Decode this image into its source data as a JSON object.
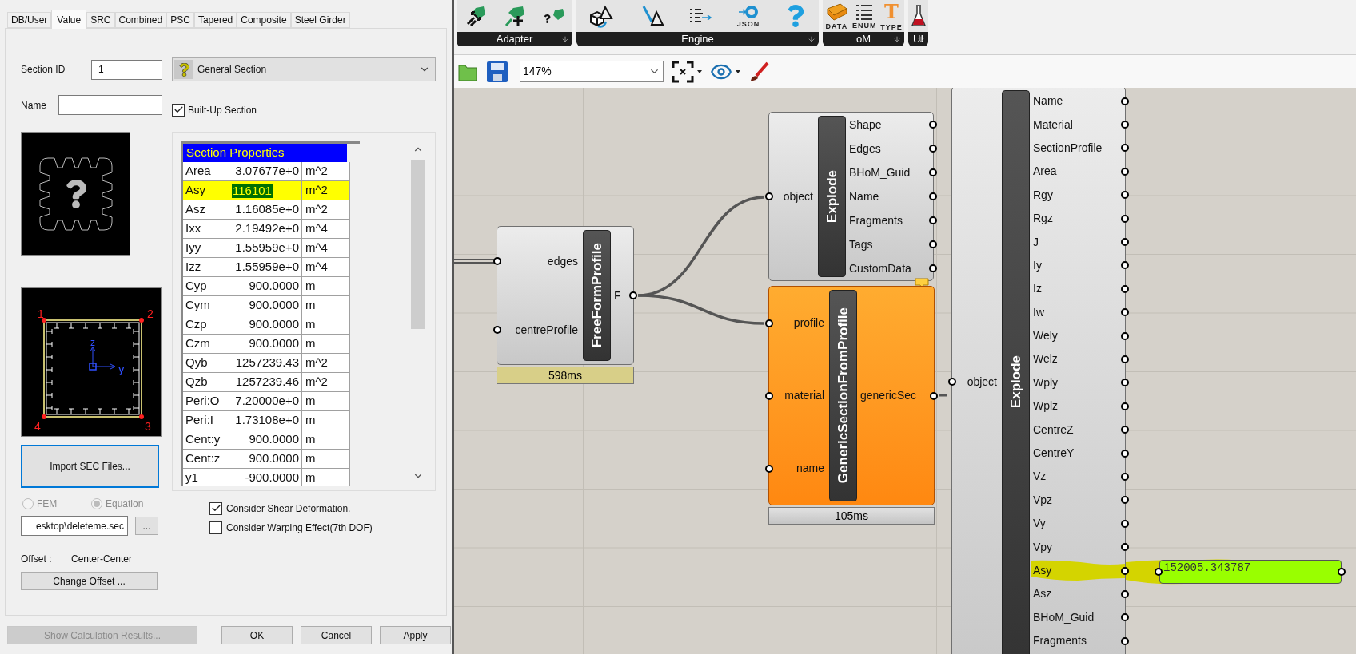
{
  "dialog": {
    "tabs": [
      {
        "label": "DB/User",
        "selected": false
      },
      {
        "label": "Value",
        "selected": true
      },
      {
        "label": "SRC",
        "selected": false
      },
      {
        "label": "Combined",
        "selected": false
      },
      {
        "label": "PSC",
        "selected": false
      },
      {
        "label": "Tapered",
        "selected": false
      },
      {
        "label": "Composite",
        "selected": false
      },
      {
        "label": "Steel Girder",
        "selected": false
      }
    ],
    "section_id": {
      "label": "Section ID",
      "value": "1"
    },
    "section_type": {
      "value": "General Section"
    },
    "name": {
      "label": "Name"
    },
    "built_up": {
      "label": "Built-Up Section",
      "checked": true
    },
    "section_drawing": {
      "corners": [
        "1",
        "2",
        "4",
        "3"
      ],
      "axes": [
        "z",
        "y"
      ]
    },
    "properties": {
      "title": "Section Properties",
      "rows": [
        {
          "name": "Area",
          "value": "3.07677e+0",
          "unit": "m^2",
          "highlighted": false
        },
        {
          "name": "Asy",
          "value": "116101",
          "unit": "m^2",
          "highlighted": true
        },
        {
          "name": "Asz",
          "value": "1.16085e+0",
          "unit": "m^2",
          "highlighted": false
        },
        {
          "name": "Ixx",
          "value": "2.19492e+0",
          "unit": "m^4",
          "highlighted": false
        },
        {
          "name": "Iyy",
          "value": "1.55959e+0",
          "unit": "m^4",
          "highlighted": false
        },
        {
          "name": "Izz",
          "value": "1.55959e+0",
          "unit": "m^4",
          "highlighted": false
        },
        {
          "name": "Cyp",
          "value": "900.0000",
          "unit": "m",
          "highlighted": false
        },
        {
          "name": "Cym",
          "value": "900.0000",
          "unit": "m",
          "highlighted": false
        },
        {
          "name": "Czp",
          "value": "900.0000",
          "unit": "m",
          "highlighted": false
        },
        {
          "name": "Czm",
          "value": "900.0000",
          "unit": "m",
          "highlighted": false
        },
        {
          "name": "Qyb",
          "value": "1257239.43",
          "unit": "m^2",
          "highlighted": false
        },
        {
          "name": "Qzb",
          "value": "1257239.46",
          "unit": "m^2",
          "highlighted": false
        },
        {
          "name": "Peri:O",
          "value": "7.20000e+0",
          "unit": "m",
          "highlighted": false
        },
        {
          "name": "Peri:I",
          "value": "1.73108e+0",
          "unit": "m",
          "highlighted": false
        },
        {
          "name": "Cent:y",
          "value": "900.0000",
          "unit": "m",
          "highlighted": false
        },
        {
          "name": "Cent:z",
          "value": "900.0000",
          "unit": "m",
          "highlighted": false
        },
        {
          "name": "y1",
          "value": "-900.0000",
          "unit": "m",
          "highlighted": false
        }
      ]
    },
    "import_button": "Import SEC Files...",
    "method": [
      {
        "label": "FEM",
        "selected": false,
        "disabled": true
      },
      {
        "label": "Equation",
        "selected": true,
        "disabled": true
      }
    ],
    "file_path": "esktop\\deleteme.sec",
    "browse_button": "...",
    "options": [
      {
        "label": "Consider Shear Deformation.",
        "checked": true
      },
      {
        "label": "Consider Warping Effect(7th DOF)",
        "checked": false
      }
    ],
    "offset": {
      "label": "Offset :",
      "value": "Center-Center",
      "button": "Change Offset ..."
    },
    "buttons": [
      {
        "label": "Show Calculation Results...",
        "disabled": true
      },
      {
        "label": "OK",
        "disabled": false
      },
      {
        "label": "Cancel",
        "disabled": false
      },
      {
        "label": "Apply",
        "disabled": false
      }
    ]
  },
  "ribbon": {
    "groups": [
      {
        "label": "Adapter",
        "icons": [
          {
            "kind": "plug-arrows"
          },
          {
            "kind": "plug-plus"
          },
          {
            "kind": "plug-help"
          }
        ]
      },
      {
        "label": "Engine",
        "icons": [
          {
            "kind": "cube"
          },
          {
            "kind": "pencil"
          },
          {
            "kind": "list-arrow"
          },
          {
            "kind": "json",
            "caption": "JSON"
          },
          {
            "kind": "help"
          }
        ]
      },
      {
        "label": "oM",
        "icons": [
          {
            "kind": "book",
            "caption": "DATA"
          },
          {
            "kind": "list",
            "caption": "ENUM"
          },
          {
            "kind": "letter",
            "glyph": "T",
            "caption": "TYPE"
          }
        ]
      },
      {
        "label": "UI",
        "icons": [
          {
            "kind": "flask"
          }
        ]
      }
    ]
  },
  "canvas_toolbar": {
    "zoom": "147%"
  },
  "canvas": {
    "nodes": [
      {
        "title": "FreeFormProfile",
        "warning": false,
        "message_balloon": false,
        "inputs": [
          "edges",
          "centreProfile"
        ],
        "outputs": [
          {
            "label": "F"
          }
        ],
        "timer": {
          "label": "598ms",
          "slow": true
        }
      },
      {
        "title": "Explode",
        "warning": false,
        "message_balloon": true,
        "inputs": [
          "object"
        ],
        "outputs": [
          {
            "label": "Shape"
          },
          {
            "label": "Edges"
          },
          {
            "label": "BHoM_Guid"
          },
          {
            "label": "Name"
          },
          {
            "label": "Fragments"
          },
          {
            "label": "Tags"
          },
          {
            "label": "CustomData"
          }
        ]
      },
      {
        "title": "GenericSectionFromProfile",
        "warning": true,
        "message_balloon": false,
        "inputs": [
          "profile",
          "material",
          "name"
        ],
        "outputs": [
          {
            "label": "genericSec"
          }
        ],
        "timer": {
          "label": "105ms",
          "slow": false
        }
      },
      {
        "title": "Explode",
        "warning": false,
        "message_balloon": false,
        "inputs": [
          "object"
        ],
        "outputs": [
          {
            "label": "Name",
            "highlighted": false
          },
          {
            "label": "Material",
            "highlighted": false
          },
          {
            "label": "SectionProfile",
            "highlighted": false
          },
          {
            "label": "Area",
            "highlighted": false
          },
          {
            "label": "Rgy",
            "highlighted": false
          },
          {
            "label": "Rgz",
            "highlighted": false
          },
          {
            "label": "J",
            "highlighted": false
          },
          {
            "label": "Iy",
            "highlighted": false
          },
          {
            "label": "Iz",
            "highlighted": false
          },
          {
            "label": "Iw",
            "highlighted": false
          },
          {
            "label": "Wely",
            "highlighted": false
          },
          {
            "label": "Welz",
            "highlighted": false
          },
          {
            "label": "Wply",
            "highlighted": false
          },
          {
            "label": "Wplz",
            "highlighted": false
          },
          {
            "label": "CentreZ",
            "highlighted": false
          },
          {
            "label": "CentreY",
            "highlighted": false
          },
          {
            "label": "Vz",
            "highlighted": false
          },
          {
            "label": "Vpz",
            "highlighted": false
          },
          {
            "label": "Vy",
            "highlighted": false
          },
          {
            "label": "Vpy",
            "highlighted": false
          },
          {
            "label": "Asy",
            "highlighted": true
          },
          {
            "label": "Asz",
            "highlighted": false
          },
          {
            "label": "BHoM_Guid",
            "highlighted": false
          },
          {
            "label": "Fragments",
            "highlighted": false
          }
        ]
      }
    ],
    "panel": {
      "value": "152005.343787"
    }
  }
}
